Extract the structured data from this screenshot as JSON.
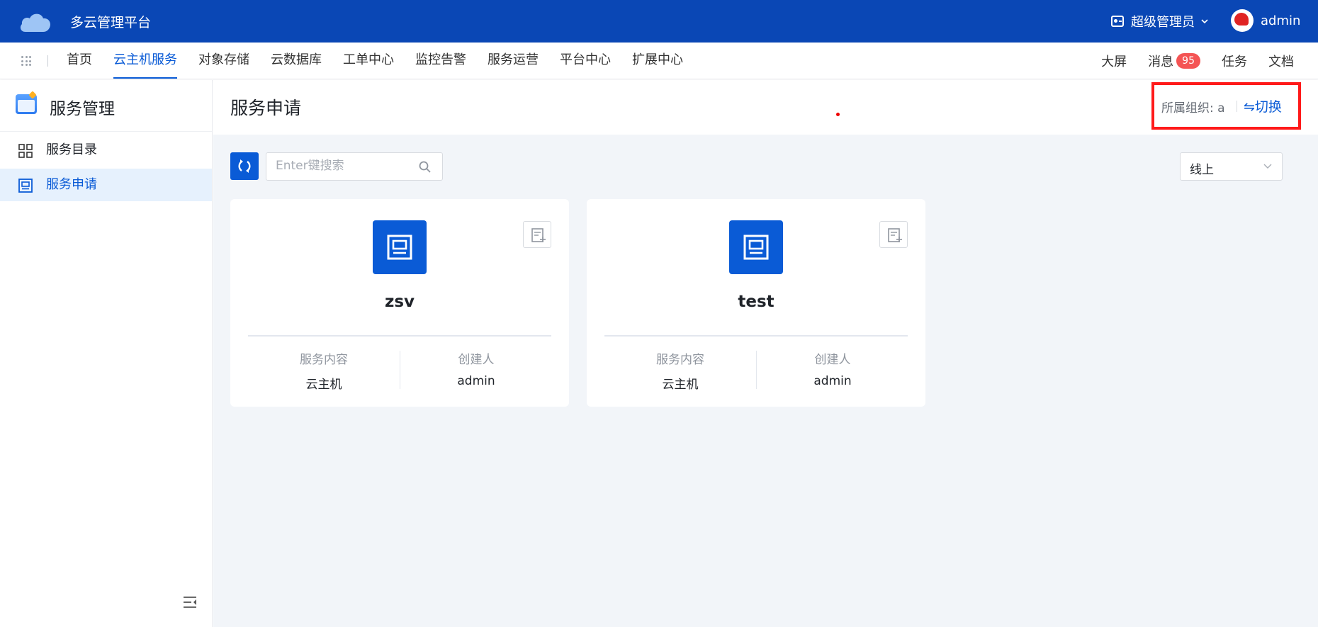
{
  "header": {
    "app_title": "多云管理平台",
    "role": "超级管理员",
    "username": "admin"
  },
  "nav": {
    "items": [
      "首页",
      "云主机服务",
      "对象存储",
      "云数据库",
      "工单中心",
      "监控告警",
      "服务运营",
      "平台中心",
      "扩展中心"
    ],
    "active_index": 1,
    "right": {
      "big_screen": "大屏",
      "messages": "消息",
      "message_count": "95",
      "tasks": "任务",
      "docs": "文档"
    }
  },
  "sidebar": {
    "title": "服务管理",
    "items": [
      {
        "label": "服务目录",
        "icon": "grid-icon"
      },
      {
        "label": "服务申请",
        "icon": "window-icon"
      }
    ],
    "active_index": 1
  },
  "main": {
    "title": "服务申请",
    "org": {
      "label": "所属组织:",
      "value": "a",
      "switch_label": "⇋切换"
    },
    "search_placeholder": "Enter键搜索",
    "status_select": "线上",
    "cards": [
      {
        "name": "zsv",
        "content_label": "服务内容",
        "content_value": "云主机",
        "creator_label": "创建人",
        "creator_value": "admin"
      },
      {
        "name": "test",
        "content_label": "服务内容",
        "content_value": "云主机",
        "creator_label": "创建人",
        "creator_value": "admin"
      }
    ]
  },
  "colors": {
    "header_bg": "#0a47b5",
    "primary": "#0a5bd6",
    "highlight_border": "#ff1a1a",
    "badge": "#f45454"
  }
}
